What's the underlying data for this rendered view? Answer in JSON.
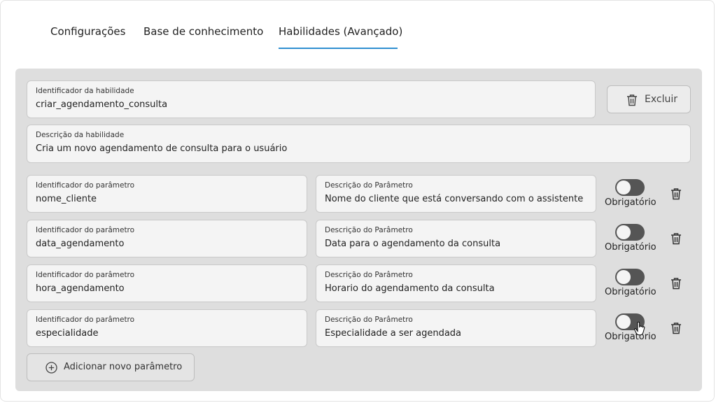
{
  "tabs": [
    {
      "label": "Configurações",
      "active": false
    },
    {
      "label": "Base de conhecimento",
      "active": false
    },
    {
      "label": "Habilidades (Avançado)",
      "active": true
    }
  ],
  "colors": {
    "accent": "#2f8fd0",
    "panel": "#dedede",
    "toggle_off": "#555555"
  },
  "skill": {
    "id_label": "Identificador da habilidade",
    "id_value": "criar_agendamento_consulta",
    "desc_label": "Descrição da habilidade",
    "desc_value": "Cria um novo agendamento de consulta para o usuário",
    "delete_label": "Excluir"
  },
  "params": [
    {
      "id_label": "Identificador do parâmetro",
      "id_value": "nome_cliente",
      "desc_label": "Descrição do Parâmetro",
      "desc_value": "Nome do cliente que está conversando com o assistente",
      "required_label": "Obrigatório",
      "required": false
    },
    {
      "id_label": "Identificador do parâmetro",
      "id_value": "data_agendamento",
      "desc_label": "Descrição do Parâmetro",
      "desc_value": "Data para o agendamento da consulta",
      "required_label": "Obrigatório",
      "required": false
    },
    {
      "id_label": "Identificador do parâmetro",
      "id_value": "hora_agendamento",
      "desc_label": "Descrição do Parâmetro",
      "desc_value": "Horario do agendamento da consulta",
      "required_label": "Obrigatório",
      "required": false
    },
    {
      "id_label": "Identificador do parâmetro",
      "id_value": "especialidade",
      "desc_label": "Descrição do Parâmetro",
      "desc_value": "Especialidade a ser agendada",
      "required_label": "Obrigatório",
      "required": false
    }
  ],
  "add_param_label": "Adicionar novo parâmetro",
  "icons": {
    "delete": "trash-icon",
    "add": "plus-circle-icon",
    "cursor": "hand-pointer-icon"
  }
}
